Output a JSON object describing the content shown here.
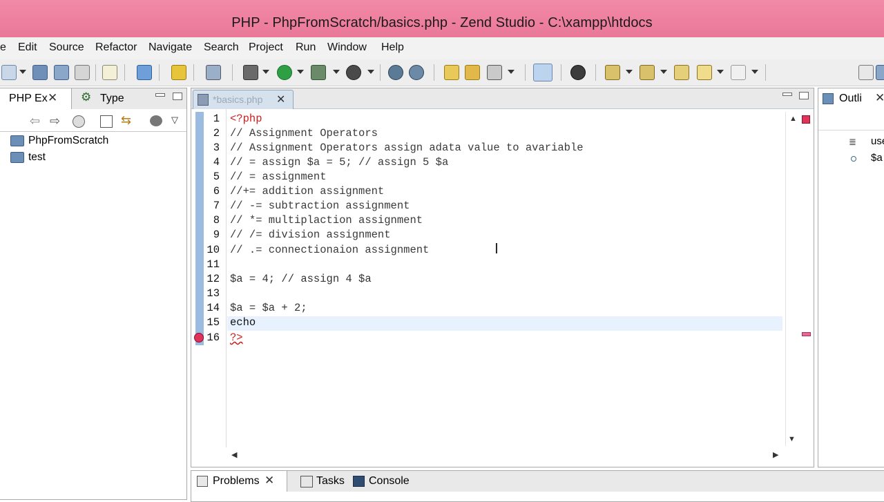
{
  "window": {
    "title": "PHP - PhpFromScratch/basics.php - Zend Studio - C:\\xampp\\htdocs"
  },
  "menu": [
    "e",
    "Edit",
    "Source",
    "Refactor",
    "Navigate",
    "Search",
    "Project",
    "Run",
    "Window",
    "Help"
  ],
  "explorer": {
    "tabs": [
      {
        "label": "PHP Ex"
      },
      {
        "label": "Type"
      }
    ],
    "tree": [
      "PhpFromScratch",
      "test"
    ]
  },
  "editor": {
    "tab_label": "*basics.php",
    "line_numbers": [
      "1",
      "2",
      "3",
      "4",
      "5",
      "6",
      "7",
      "8",
      "9",
      "10",
      "11",
      "12",
      "13",
      "14",
      "15",
      "16"
    ],
    "lines": [
      "<?php",
      "// Assignment Operators",
      "// Assignment Operators assign adata value to avariable",
      "// = assign $a = 5; // assign 5 $a",
      "// = assignment",
      "//+= addition assignment",
      "// -= subtraction assignment",
      "// *= multiplaction assignment",
      "// /= division assignment",
      "// .= connectionaion assignment",
      "",
      "$a = 4; // assign 4 $a",
      "",
      "$a = $a + 2;",
      "echo",
      "?>"
    ]
  },
  "outline": {
    "tab_label": "Outli",
    "items": [
      "use",
      "$a"
    ]
  },
  "bottom": {
    "tabs": [
      "Problems",
      "Tasks",
      "Console"
    ]
  },
  "colors": {
    "title_bar": "#ee7f9e",
    "php_tag": "#d11d1d",
    "current_line": "#e8f2fe",
    "error_marker": "#e0335a"
  }
}
